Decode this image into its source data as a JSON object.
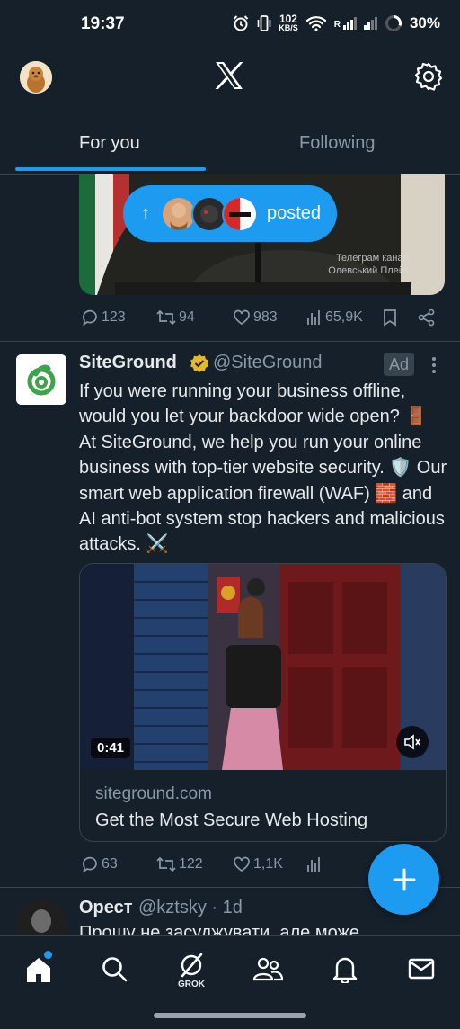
{
  "status_bar": {
    "time": "19:37",
    "speed_value": "102",
    "speed_unit": "KB/S",
    "network_label": "R",
    "battery": "30%",
    "battery_level": 0.3
  },
  "header": {
    "logo_icon": "x-logo-icon",
    "settings_icon": "gear-icon"
  },
  "tabs": [
    {
      "label": "For you",
      "active": true
    },
    {
      "label": "Following",
      "active": false
    }
  ],
  "post1": {
    "watermark_line1": "Телеграм канал",
    "watermark_line2": "Олевський Плейт",
    "posted_label": "posted",
    "stats": {
      "replies": "123",
      "reposts": "94",
      "likes": "983",
      "views": "65,9K"
    }
  },
  "ad_post": {
    "name": "SiteGround",
    "handle": "@SiteGround",
    "badge": "Ad",
    "text": "If you were running your business offline, would you let your backdoor wide open? 🚪 At SiteGround, we help you run your online business with top-tier website security. 🛡️ Our smart web application firewall (WAF) 🧱 and AI anti-bot system stop hackers and malicious attacks. ⚔️",
    "video_duration": "0:41",
    "card_domain": "siteground.com",
    "card_title": "Get the Most Secure Web Hosting",
    "stats": {
      "replies": "63",
      "reposts": "122",
      "likes": "1,1K"
    }
  },
  "post3": {
    "name": "Орест",
    "handle_time": "@kztsky · 1d",
    "text": "Прошу не засуджувати, але може"
  },
  "bottom_nav": {
    "grok_label": "GROK",
    "items": [
      "home-icon",
      "search-icon",
      "grok-icon",
      "communities-icon",
      "notifications-icon",
      "messages-icon"
    ]
  },
  "colors": {
    "accent": "#1d9bf0",
    "background": "#15202b",
    "muted": "#8b98a5"
  }
}
